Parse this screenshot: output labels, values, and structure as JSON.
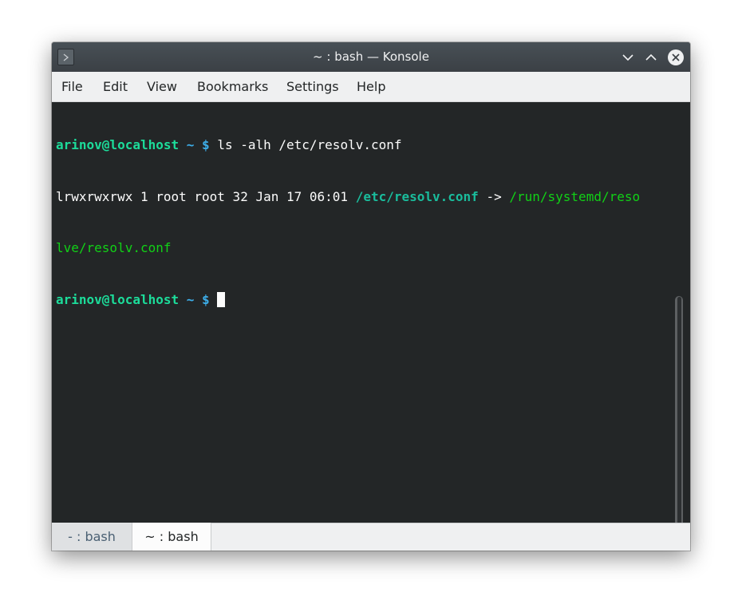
{
  "window": {
    "title": "~ : bash — Konsole"
  },
  "titlebar_buttons": {
    "minimize": "chevron-down-icon",
    "maximize": "chevron-up-icon",
    "close": "close-icon"
  },
  "menubar": {
    "items": [
      "File",
      "Edit",
      "View",
      "Bookmarks",
      "Settings",
      "Help"
    ]
  },
  "terminal": {
    "lines": [
      {
        "prompt_user": "arinov@localhost",
        "prompt_path": "~ $",
        "command": "ls -alh /etc/resolv.conf"
      },
      {
        "listing": "lrwxrwxrwx 1 root root 32 Jan 17 06:01",
        "link_name": "/etc/resolv.conf",
        "arrow": "->",
        "target_part1": "/run/systemd/reso",
        "target_part2": "lve/resolv.conf"
      },
      {
        "prompt_user": "arinov@localhost",
        "prompt_path": "~ $",
        "command": ""
      }
    ]
  },
  "tabs": [
    {
      "label": "- : bash",
      "active": false
    },
    {
      "label": "~ : bash",
      "active": true
    }
  ],
  "colors": {
    "terminal_bg": "#232627",
    "prompt_user": "#1cdc9a",
    "prompt_path": "#3daee9",
    "symlink": "#1abc9c",
    "symlink_target": "#11d116",
    "titlebar": "#3b4045",
    "menubar": "#eff0f1"
  }
}
